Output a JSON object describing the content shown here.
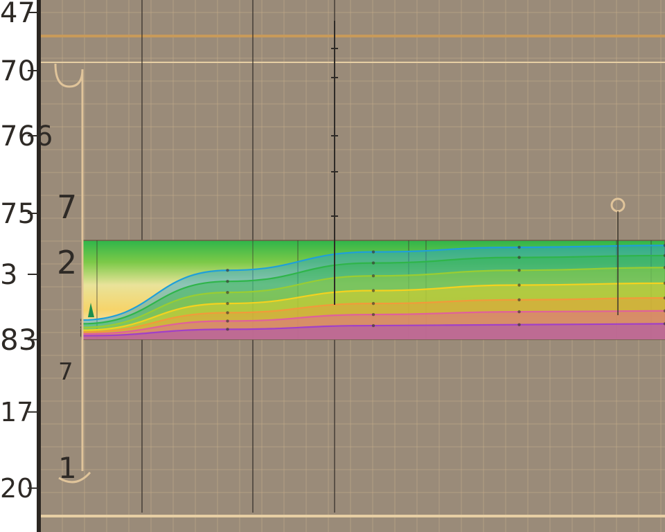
{
  "chart_data": {
    "type": "area",
    "title": "",
    "xlabel": "",
    "ylabel": "",
    "grid": true,
    "left_labels": [
      {
        "text": "47"
      },
      {
        "text": "70"
      },
      {
        "text": "766"
      },
      {
        "text": "75"
      },
      {
        "text": "3"
      },
      {
        "text": "83"
      },
      {
        "text": "17"
      },
      {
        "text": "20"
      }
    ],
    "inner_labels": [
      {
        "text": "7"
      },
      {
        "text": "2"
      },
      {
        "text": "7"
      },
      {
        "text": "1"
      }
    ],
    "series": [
      {
        "color": "#1f9fd9",
        "values": [
          0.18,
          0.72,
          0.92,
          0.97,
          0.99
        ]
      },
      {
        "color": "#2fb54a",
        "values": [
          0.14,
          0.6,
          0.8,
          0.86,
          0.88
        ]
      },
      {
        "color": "#9acd32",
        "values": [
          0.1,
          0.48,
          0.66,
          0.72,
          0.75
        ]
      },
      {
        "color": "#f4d21f",
        "values": [
          0.07,
          0.36,
          0.5,
          0.56,
          0.58
        ]
      },
      {
        "color": "#f29a3a",
        "values": [
          0.05,
          0.26,
          0.36,
          0.4,
          0.42
        ]
      },
      {
        "color": "#e0609b",
        "values": [
          0.03,
          0.17,
          0.24,
          0.27,
          0.28
        ]
      },
      {
        "color": "#a040c8",
        "values": [
          0.01,
          0.08,
          0.12,
          0.13,
          0.14
        ]
      }
    ],
    "colors": {
      "paper": "#9a8b79",
      "gridline": "#c8b08a",
      "axis": "#2e2a26",
      "band_top": "#2fb54a",
      "band_bottom": "#f5f1e8",
      "marker": "#1e8f4e"
    }
  }
}
